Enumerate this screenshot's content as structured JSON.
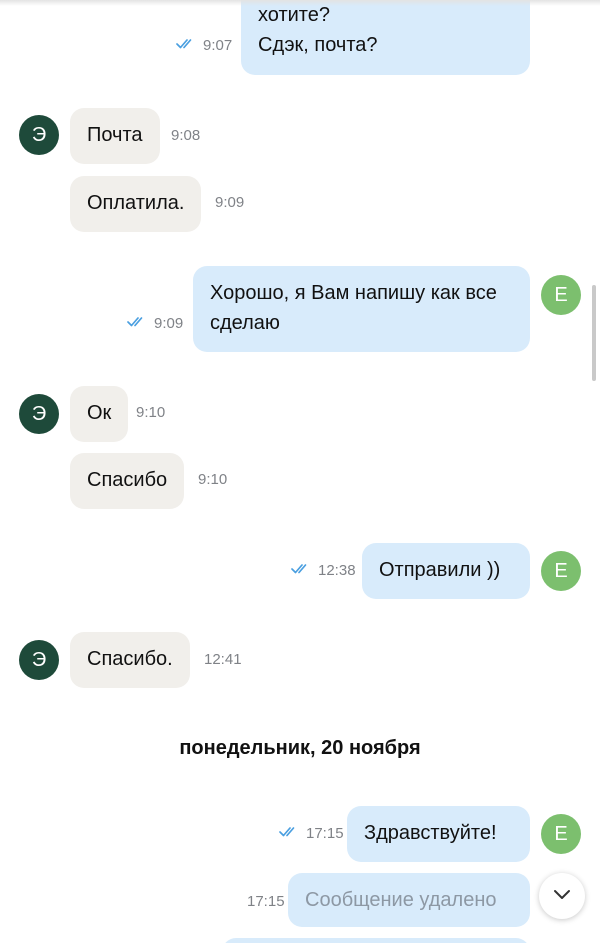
{
  "messages": [
    {
      "lines": [
        "хотите?",
        "Сдэк, почта?"
      ],
      "time": "9:07",
      "direction": "out",
      "read": true
    },
    {
      "lines": [
        "Почта"
      ],
      "time": "9:08",
      "direction": "in",
      "avatar": "Э"
    },
    {
      "lines": [
        "Оплатила."
      ],
      "time": "9:09",
      "direction": "in"
    },
    {
      "lines": [
        "Хорошо, я Вам напишу как все",
        "сделаю"
      ],
      "time": "9:09",
      "direction": "out",
      "read": true,
      "avatar": "Е"
    },
    {
      "lines": [
        "Ок"
      ],
      "time": "9:10",
      "direction": "in",
      "avatar": "Э"
    },
    {
      "lines": [
        "Спасибо"
      ],
      "time": "9:10",
      "direction": "in"
    },
    {
      "lines": [
        "Отправили ))"
      ],
      "time": "12:38",
      "direction": "out",
      "read": true,
      "avatar": "Е"
    },
    {
      "lines": [
        "Спасибо."
      ],
      "time": "12:41",
      "direction": "in",
      "avatar": "Э"
    },
    {
      "lines": [
        "Здравствуйте!"
      ],
      "time": "17:15",
      "direction": "out",
      "read": true,
      "avatar": "Е"
    },
    {
      "lines": [
        "Сообщение удалено"
      ],
      "time": "17:15",
      "direction": "out",
      "deleted": true
    }
  ],
  "date_separator": "понедельник, 20 ноября",
  "colors": {
    "incoming_bubble": "#f1efeb",
    "outgoing_bubble": "#d8ebfb",
    "read_ticks": "#4a9fe0",
    "avatar_them": "#1e4a3a",
    "avatar_me": "#7cbf6e"
  },
  "icons": {
    "read_status": "double-check-icon",
    "scroll_down": "chevron-down-icon"
  }
}
